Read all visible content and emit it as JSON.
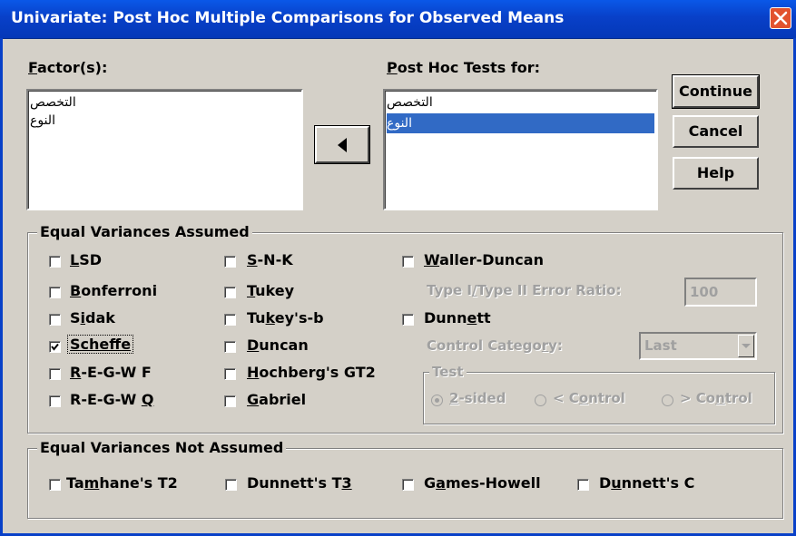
{
  "window": {
    "title": "Univariate: Post Hoc Multiple Comparisons for Observed Means"
  },
  "factors": {
    "label_pre": "",
    "label_key": "F",
    "label_post": "actor(s):",
    "items": [
      "التخصص",
      "النوع"
    ]
  },
  "post_hoc": {
    "label_pre": "",
    "label_key": "P",
    "label_post": "ost Hoc Tests for:",
    "items": [
      "التخصص",
      "النوع"
    ],
    "selected_index": 1
  },
  "buttons": {
    "continue": "Continue",
    "cancel": "Cancel",
    "help": "Help"
  },
  "equal_assumed": {
    "title": "Equal Variances Assumed",
    "col1": [
      {
        "pre": "",
        "key": "L",
        "post": "SD",
        "checked": false
      },
      {
        "pre": "",
        "key": "B",
        "post": "onferroni",
        "checked": false
      },
      {
        "pre": "S",
        "key": "i",
        "post": "dak",
        "checked": false
      },
      {
        "pre": "",
        "key": "Scheffe",
        "post": "",
        "checked": true
      },
      {
        "pre": "",
        "key": "R",
        "post": "-E-G-W F",
        "checked": false
      },
      {
        "pre": "R-E-G-W ",
        "key": "Q",
        "post": "",
        "checked": false
      }
    ],
    "col2": [
      {
        "pre": "",
        "key": "S",
        "post": "-N-K",
        "checked": false
      },
      {
        "pre": "",
        "key": "T",
        "post": "ukey",
        "checked": false
      },
      {
        "pre": "Tu",
        "key": "k",
        "post": "ey's-b",
        "checked": false
      },
      {
        "pre": "",
        "key": "D",
        "post": "uncan",
        "checked": false
      },
      {
        "pre": "",
        "key": "H",
        "post": "ochberg's GT2",
        "checked": false
      },
      {
        "pre": "",
        "key": "G",
        "post": "abriel",
        "checked": false
      }
    ],
    "waller": {
      "pre": "",
      "key": "W",
      "post": "aller-Duncan",
      "checked": false
    },
    "error_ratio_label": {
      "pre": "Type I",
      "key": "/",
      "post": "Type II Error Ratio:"
    },
    "error_ratio_value": "100",
    "dunnett": {
      "pre": "Dunn",
      "key": "e",
      "post": "tt",
      "checked": false
    },
    "control_label": {
      "pre": "Control Catego",
      "key": "r",
      "post": "y:"
    },
    "control_value": "Last",
    "test_title": "Test",
    "test_options": [
      {
        "pre": "",
        "key": "2",
        "post": "-sided",
        "selected": true
      },
      {
        "pre": "< C",
        "key": "o",
        "post": "ntrol",
        "selected": false
      },
      {
        "pre": "> Co",
        "key": "n",
        "post": "trol",
        "selected": false
      }
    ]
  },
  "equal_not_assumed": {
    "title": "Equal Variances Not Assumed",
    "items": [
      {
        "pre": "Ta",
        "key": "m",
        "post": "hane's T2",
        "checked": false
      },
      {
        "pre": "Dunnett's T",
        "key": "3",
        "post": "",
        "checked": false
      },
      {
        "pre": "G",
        "key": "a",
        "post": "mes-Howell",
        "checked": false
      },
      {
        "pre": "D",
        "key": "u",
        "post": "nnett's C",
        "checked": false
      }
    ]
  }
}
